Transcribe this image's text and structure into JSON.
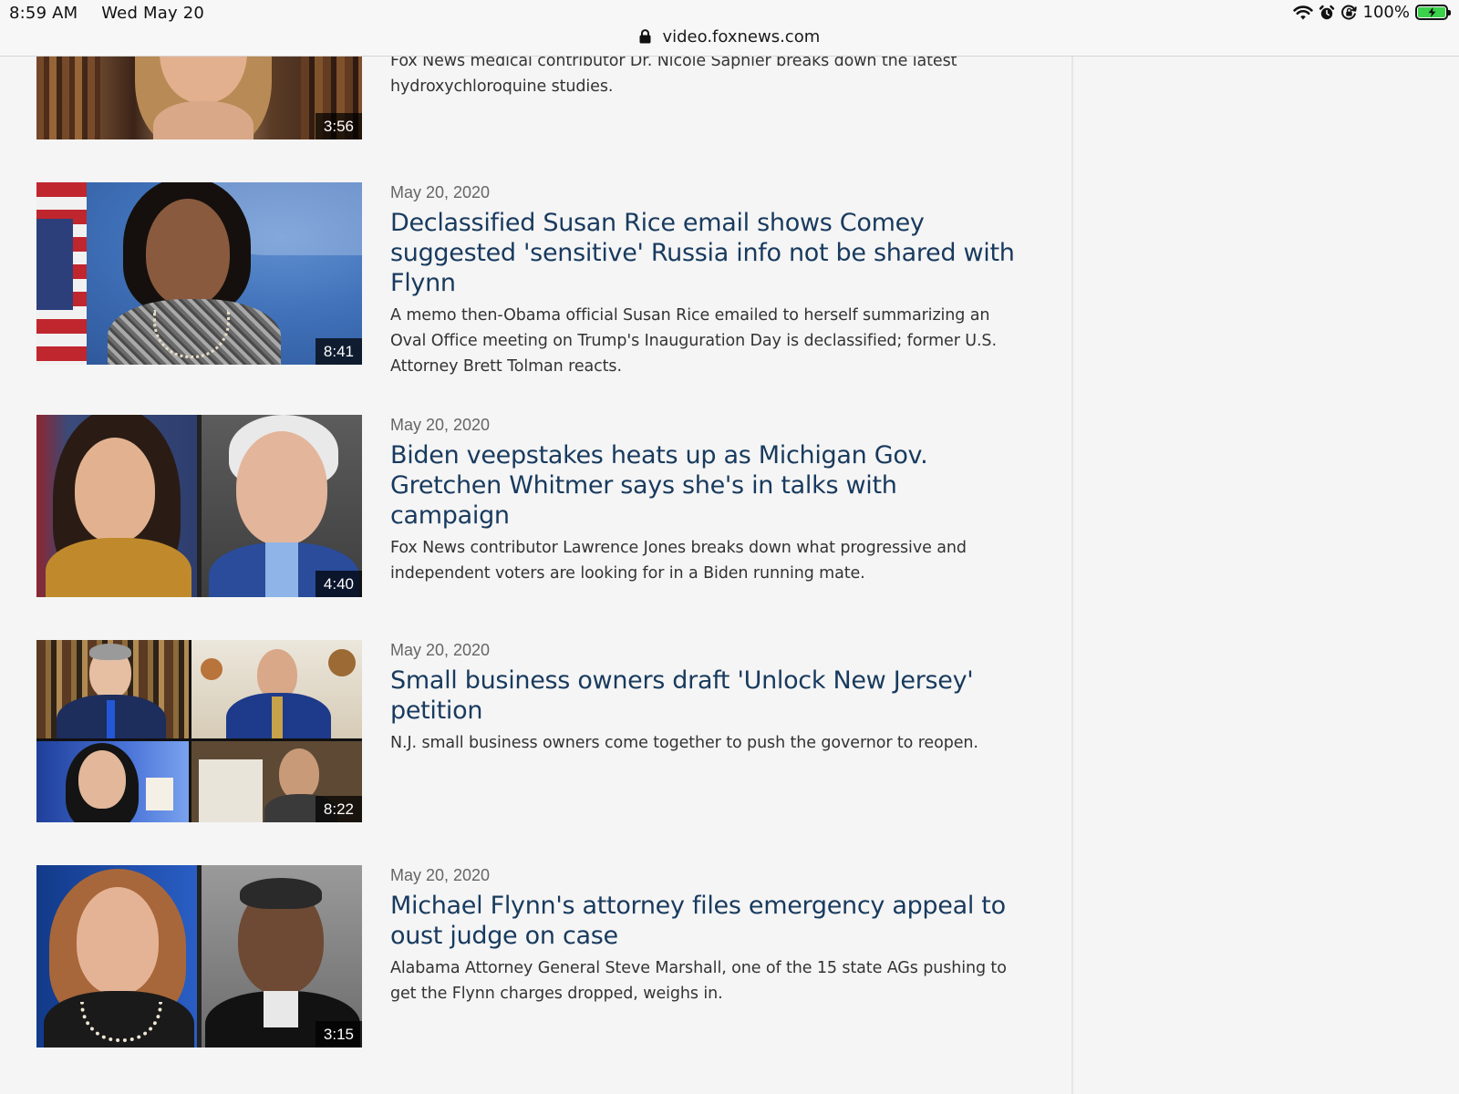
{
  "status_bar": {
    "time": "8:59 AM",
    "date": "Wed May 20",
    "battery": "100%",
    "battery_level": 1.0
  },
  "browser": {
    "url": "video.foxnews.com"
  },
  "videos": [
    {
      "date": "",
      "title": "",
      "description": "Fox News medical contributor Dr. Nicole Saphier breaks down the latest hydroxychloroquine studies.",
      "duration": "3:56",
      "thumb_icon": "woman-portrait-thumbnail"
    },
    {
      "date": "May 20, 2020",
      "title": "Declassified Susan Rice email shows Comey suggested 'sensitive' Russia info not be shared with Flynn",
      "description": "A memo then-Obama official Susan Rice emailed to herself summarizing an Oval Office meeting on Trump's Inauguration Day is declassified; former U.S. Attorney Brett Tolman reacts.",
      "duration": "8:41",
      "thumb_icon": "press-briefing-thumbnail"
    },
    {
      "date": "May 20, 2020",
      "title": "Biden veepstakes heats up as Michigan Gov. Gretchen Whitmer says she's in talks with campaign",
      "description": "Fox News contributor Lawrence Jones breaks down what progressive and independent voters are looking for in a Biden running mate.",
      "duration": "4:40",
      "thumb_icon": "split-portrait-thumbnail"
    },
    {
      "date": "May 20, 2020",
      "title": "Small business owners draft 'Unlock New Jersey' petition",
      "description": "N.J. small business owners come together to push the governor to reopen.",
      "duration": "8:22",
      "thumb_icon": "video-call-grid-thumbnail"
    },
    {
      "date": "May 20, 2020",
      "title": "Michael Flynn's attorney files emergency appeal to oust judge on case",
      "description": "Alabama Attorney General Steve Marshall, one of the 15 state AGs pushing to get the Flynn charges dropped, weighs in.",
      "duration": "3:15",
      "thumb_icon": "split-portrait-thumbnail"
    }
  ],
  "colors": {
    "title": "#183a5e",
    "page_background": "#f5f5f5",
    "battery_green": "#3ad14b"
  }
}
